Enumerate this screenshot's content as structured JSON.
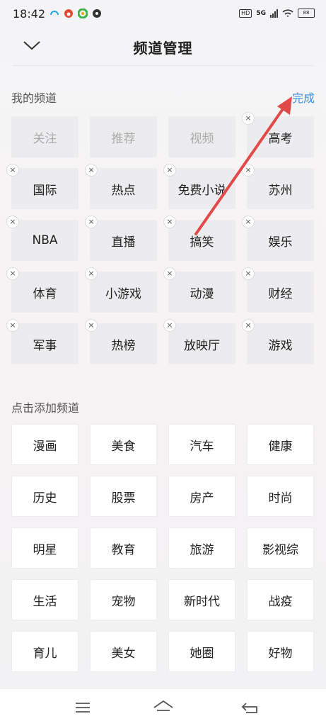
{
  "status": {
    "time": "18:42",
    "hd": "HD",
    "network": "5G",
    "battery": "88"
  },
  "header": {
    "title": "频道管理",
    "back_icon": "chevron-down-icon"
  },
  "my_channels": {
    "title": "我的频道",
    "done_label": "完成",
    "fixed": [
      "关注",
      "推荐",
      "视频"
    ],
    "items": [
      "高考",
      "国际",
      "热点",
      "免费小说",
      "苏州",
      "NBA",
      "直播",
      "搞笑",
      "娱乐",
      "体育",
      "小游戏",
      "动漫",
      "财经",
      "军事",
      "热榜",
      "放映厅",
      "游戏"
    ]
  },
  "add_channels": {
    "title": "点击添加频道",
    "items": [
      "漫画",
      "美食",
      "汽车",
      "健康",
      "历史",
      "股票",
      "房产",
      "时尚",
      "明星",
      "教育",
      "旅游",
      "影视综",
      "生活",
      "宠物",
      "新时代",
      "战疫",
      "育儿",
      "美女",
      "她圈",
      "好物"
    ]
  },
  "nav": {
    "menu_icon": "menu-icon",
    "home_icon": "home-icon",
    "back_icon": "back-icon"
  },
  "colors": {
    "accent": "#3a8fd9",
    "arrow": "#e24a4a"
  }
}
